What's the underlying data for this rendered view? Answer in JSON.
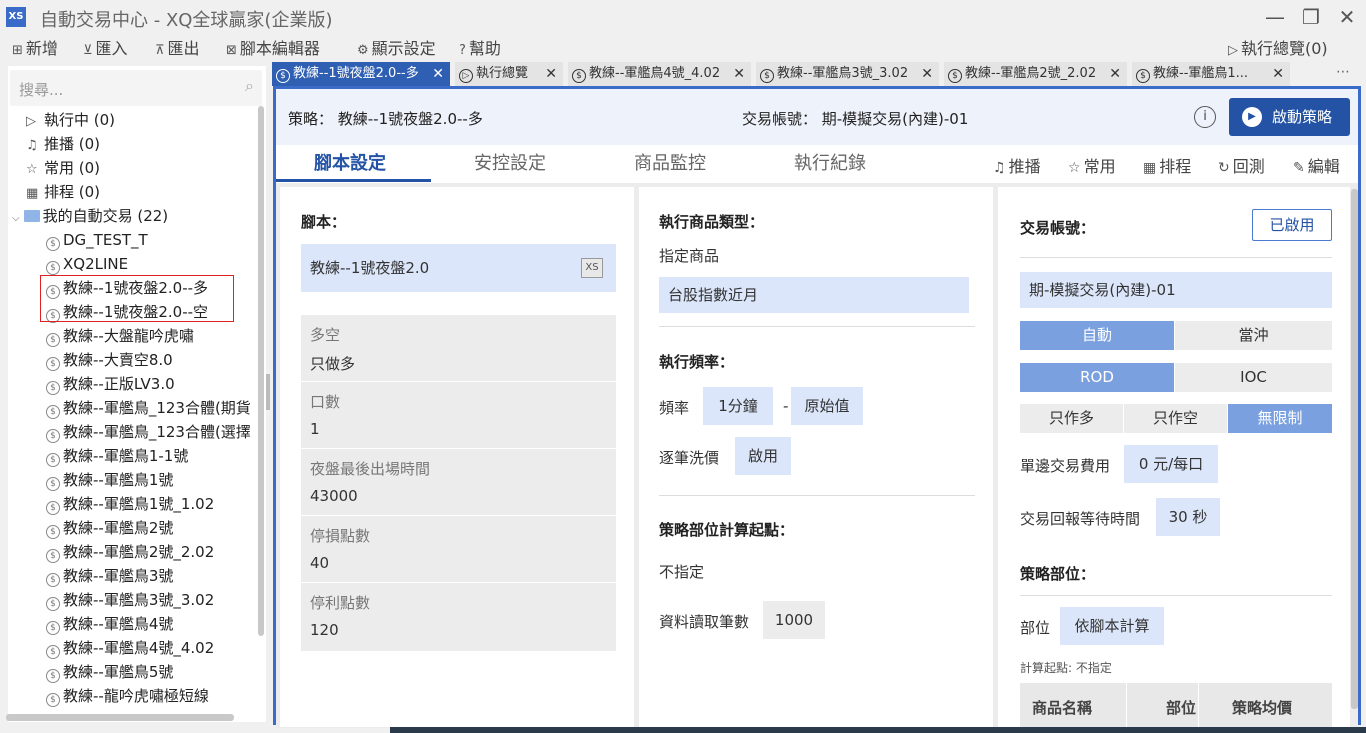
{
  "window": {
    "logo": "XS",
    "title": "自動交易中心 - XQ全球贏家(企業版)"
  },
  "menu": {
    "items": [
      {
        "icon": "plus-icon",
        "label": "新增"
      },
      {
        "icon": "import-icon",
        "label": "匯入"
      },
      {
        "icon": "export-icon",
        "label": "匯出"
      },
      {
        "icon": "script-editor-icon",
        "label": "腳本編輯器"
      },
      {
        "icon": "gear-icon",
        "label": "顯示設定"
      },
      {
        "icon": "help-icon",
        "label": "幫助"
      }
    ],
    "right": "執行總覽(0)"
  },
  "sidebar": {
    "search_placeholder": "搜尋...",
    "items": [
      "執行中 (0)",
      "推播 (0)",
      "常用 (0)",
      "排程 (0)",
      "我的自動交易 (22)",
      "DG_TEST_T",
      "XQ2LINE",
      "教練--1號夜盤2.0--多",
      "教練--1號夜盤2.0--空",
      "教練--大盤龍吟虎嘯",
      "教練--大賣空8.0",
      "教練--正版LV3.0",
      "教練--軍艦鳥_123合體(期貨",
      "教練--軍艦鳥_123合體(選擇",
      "教練--軍艦鳥1-1號",
      "教練--軍艦鳥1號",
      "教練--軍艦鳥1號_1.02",
      "教練--軍艦鳥2號",
      "教練--軍艦鳥2號_2.02",
      "教練--軍艦鳥3號",
      "教練--軍艦鳥3號_3.02",
      "教練--軍艦鳥4號",
      "教練--軍艦鳥4號_4.02",
      "教練--軍艦鳥5號",
      "教練--龍吟虎嘯極短線"
    ]
  },
  "tabs": [
    "教練--1號夜盤2.0--多",
    "執行總覽",
    "教練--軍艦鳥4號_4.02",
    "教練--軍艦鳥3號_3.02",
    "教練--軍艦鳥2號_2.02",
    "教練--軍艦鳥1..."
  ],
  "header": {
    "strategy": "策略： 教練--1號夜盤2.0--多",
    "account": "交易帳號： 期-模擬交易(內建)-01",
    "start_label": "啟動策略"
  },
  "subtabs": [
    "腳本設定",
    "安控設定",
    "商品監控",
    "執行紀錄"
  ],
  "actions": [
    "推播",
    "常用",
    "排程",
    "回測",
    "編輯"
  ],
  "col1": {
    "script_title": "腳本：",
    "script_value": "教練--1號夜盤2.0",
    "params": [
      {
        "label": "多空",
        "value": "只做多"
      },
      {
        "label": "口數",
        "value": "1"
      },
      {
        "label": "夜盤最後出場時間",
        "value": "43000"
      },
      {
        "label": "停損點數",
        "value": "40"
      },
      {
        "label": "停利點數",
        "value": "120"
      }
    ]
  },
  "col2": {
    "product_type_title": "執行商品類型：",
    "product_sub": "指定商品",
    "product_value": "台股指數近月",
    "freq_title": "執行頻率：",
    "freq_label": "頻率",
    "freq_value": "1分鐘",
    "freq_dash": "-",
    "freq_value2": "原始值",
    "tick_label": "逐筆洗價",
    "tick_value": "啟用",
    "calc_title": "策略部位計算起點：",
    "calc_value": "不指定",
    "read_label": "資料讀取筆數",
    "read_value": "1000"
  },
  "col3": {
    "acct_title": "交易帳號：",
    "enabled_label": "已啟用",
    "acct_value": "期-模擬交易(內建)-01",
    "mode": [
      "自動",
      "當沖"
    ],
    "order_type": [
      "ROD",
      "IOC"
    ],
    "direction": [
      "只作多",
      "只作空",
      "無限制"
    ],
    "fee_label": "單邊交易費用",
    "fee_value": "0 元/每口",
    "wait_label": "交易回報等待時間",
    "wait_value": "30 秒",
    "pos_title": "策略部位：",
    "pos_label": "部位",
    "pos_value": "依腳本計算",
    "calc_note": "計算起點: 不指定",
    "table_headers": [
      "商品名稱",
      "部位",
      "策略均價"
    ]
  },
  "colors": {
    "accent": "#2453a5",
    "tab_active": "#2f5fb3",
    "chip": "#dbe6fa",
    "seg_on": "#7aa0e0",
    "highlight": "#dd2222"
  }
}
